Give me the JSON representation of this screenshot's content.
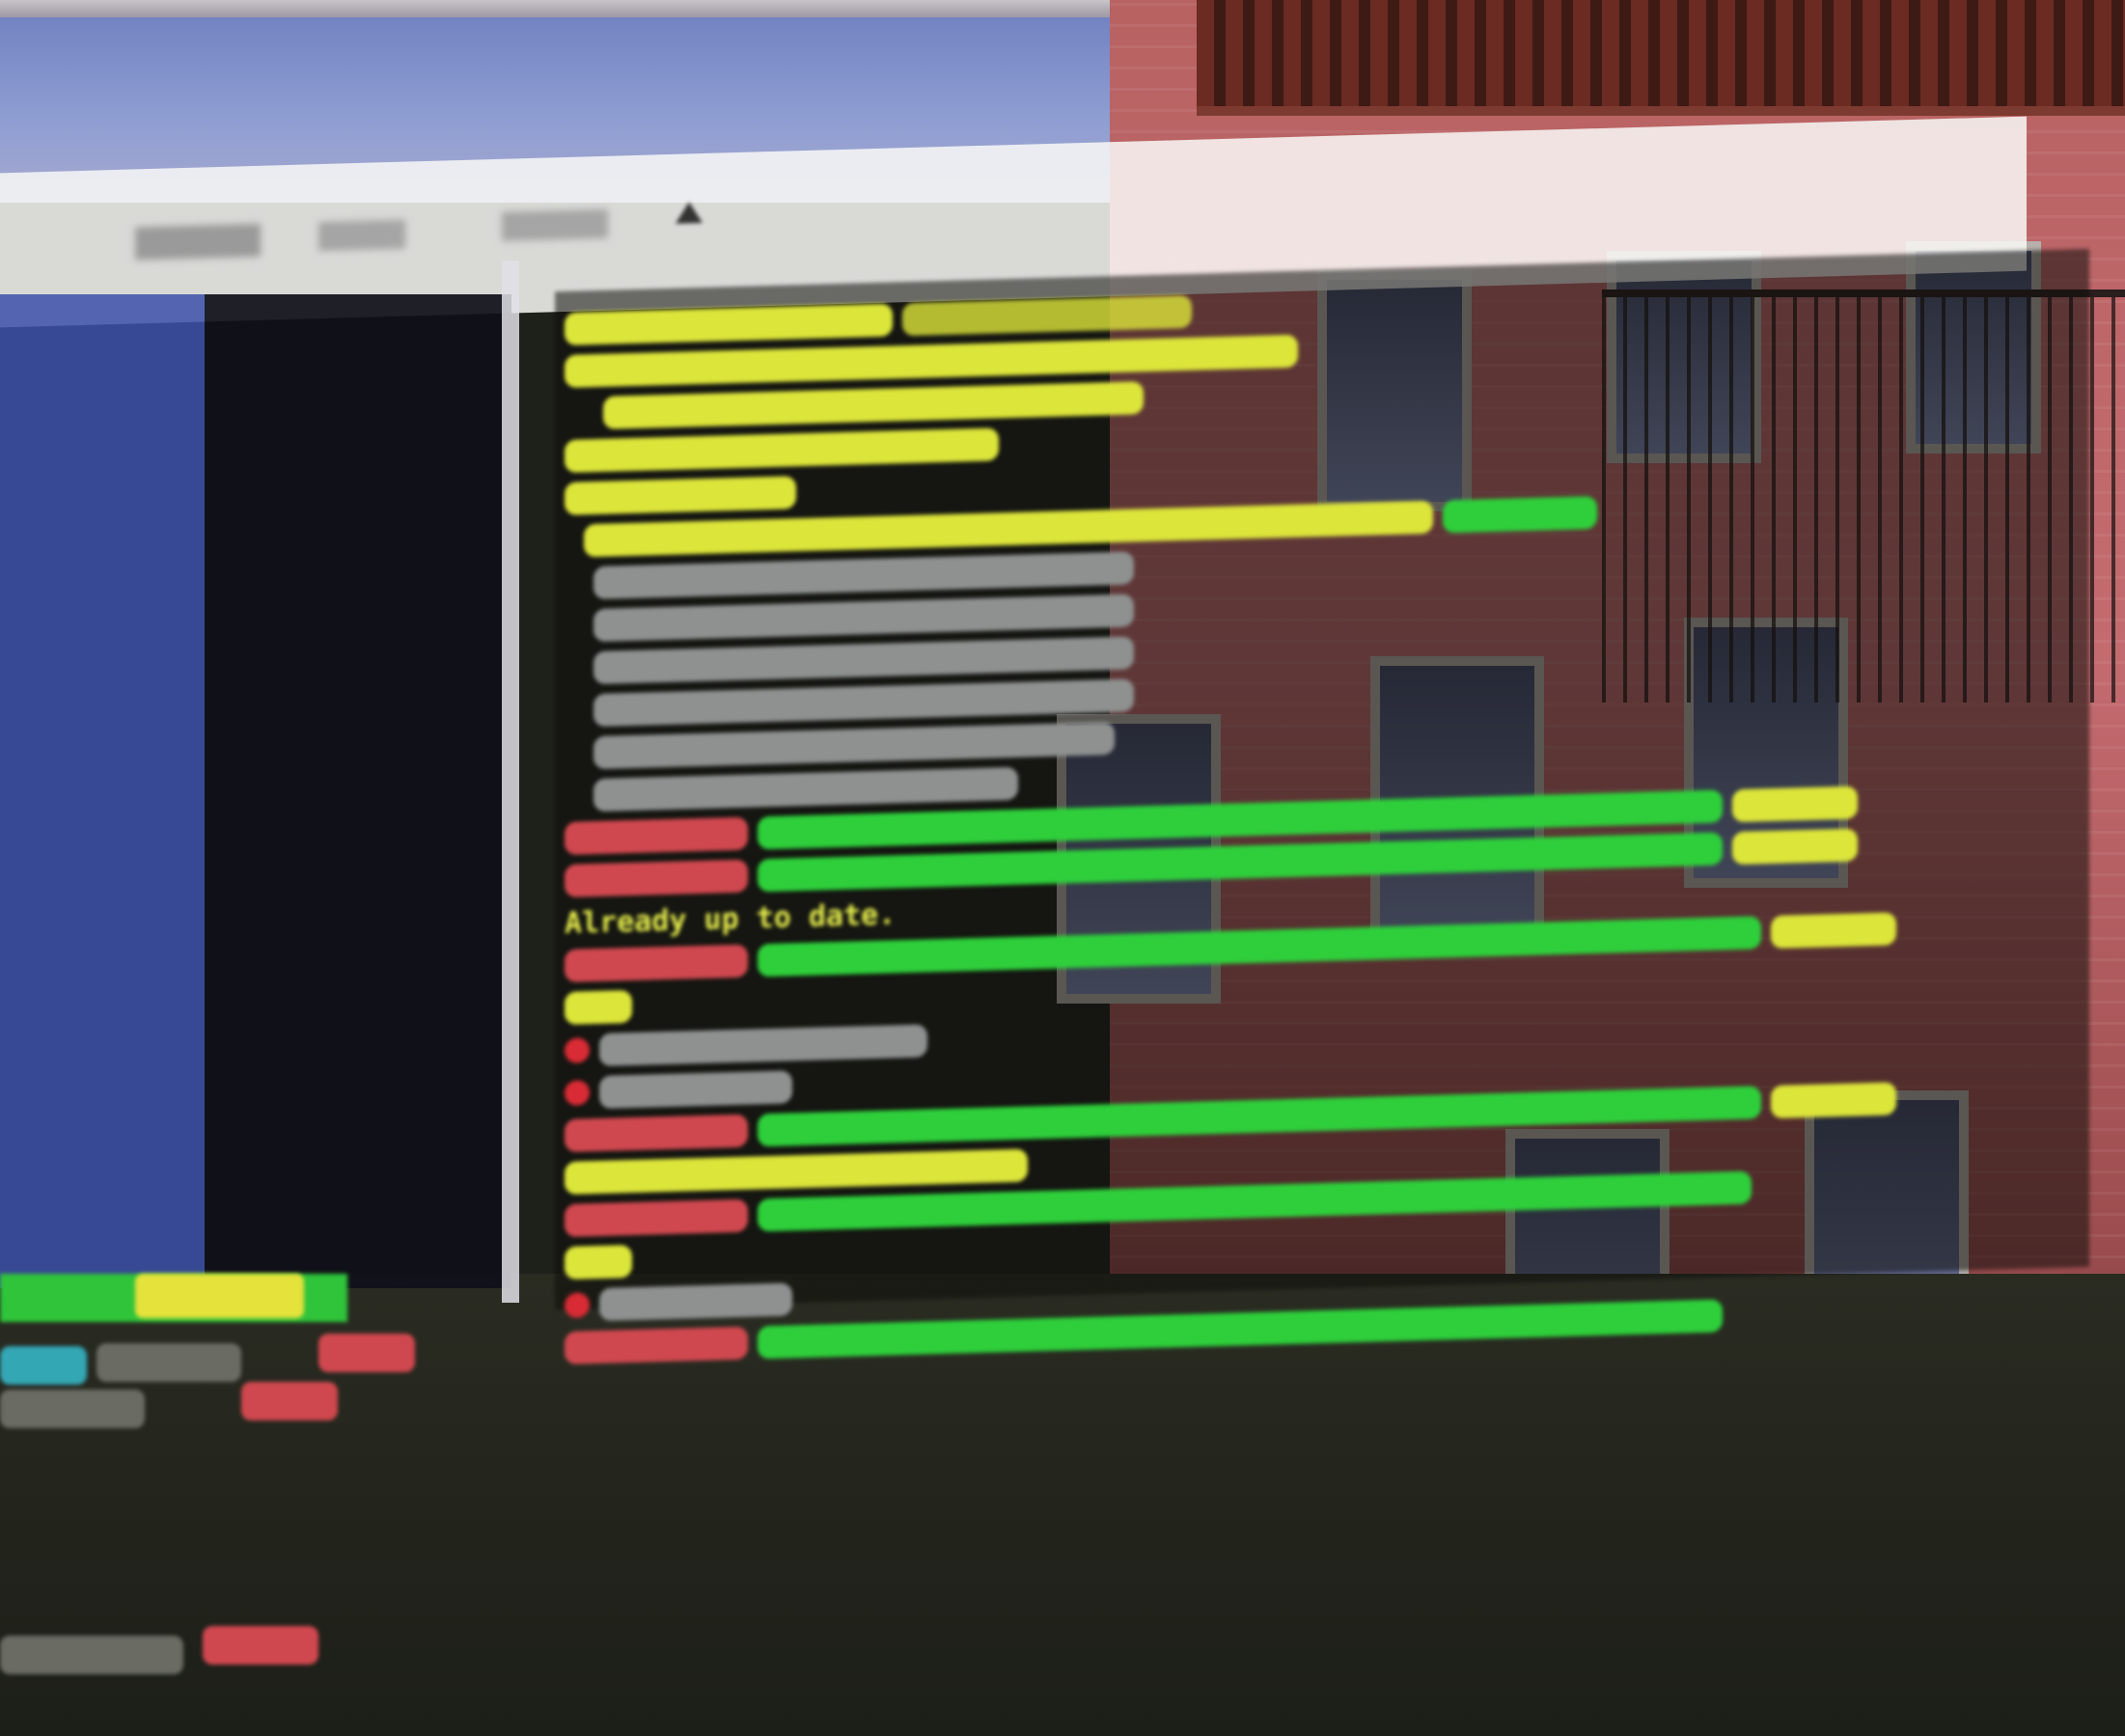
{
  "scene": {
    "description_colors": {
      "sky": "#8f9ed2",
      "brick": "#c46b70",
      "terminal_yellow": "#e7ef4c",
      "terminal_green": "#3fd94a",
      "terminal_red": "#d0484f"
    },
    "icons": [
      "toolbar-icon",
      "warning-icon",
      "status-dot-icon"
    ]
  },
  "terminal": {
    "visible_text": {
      "already_up_to_date": "Already up to date."
    }
  }
}
